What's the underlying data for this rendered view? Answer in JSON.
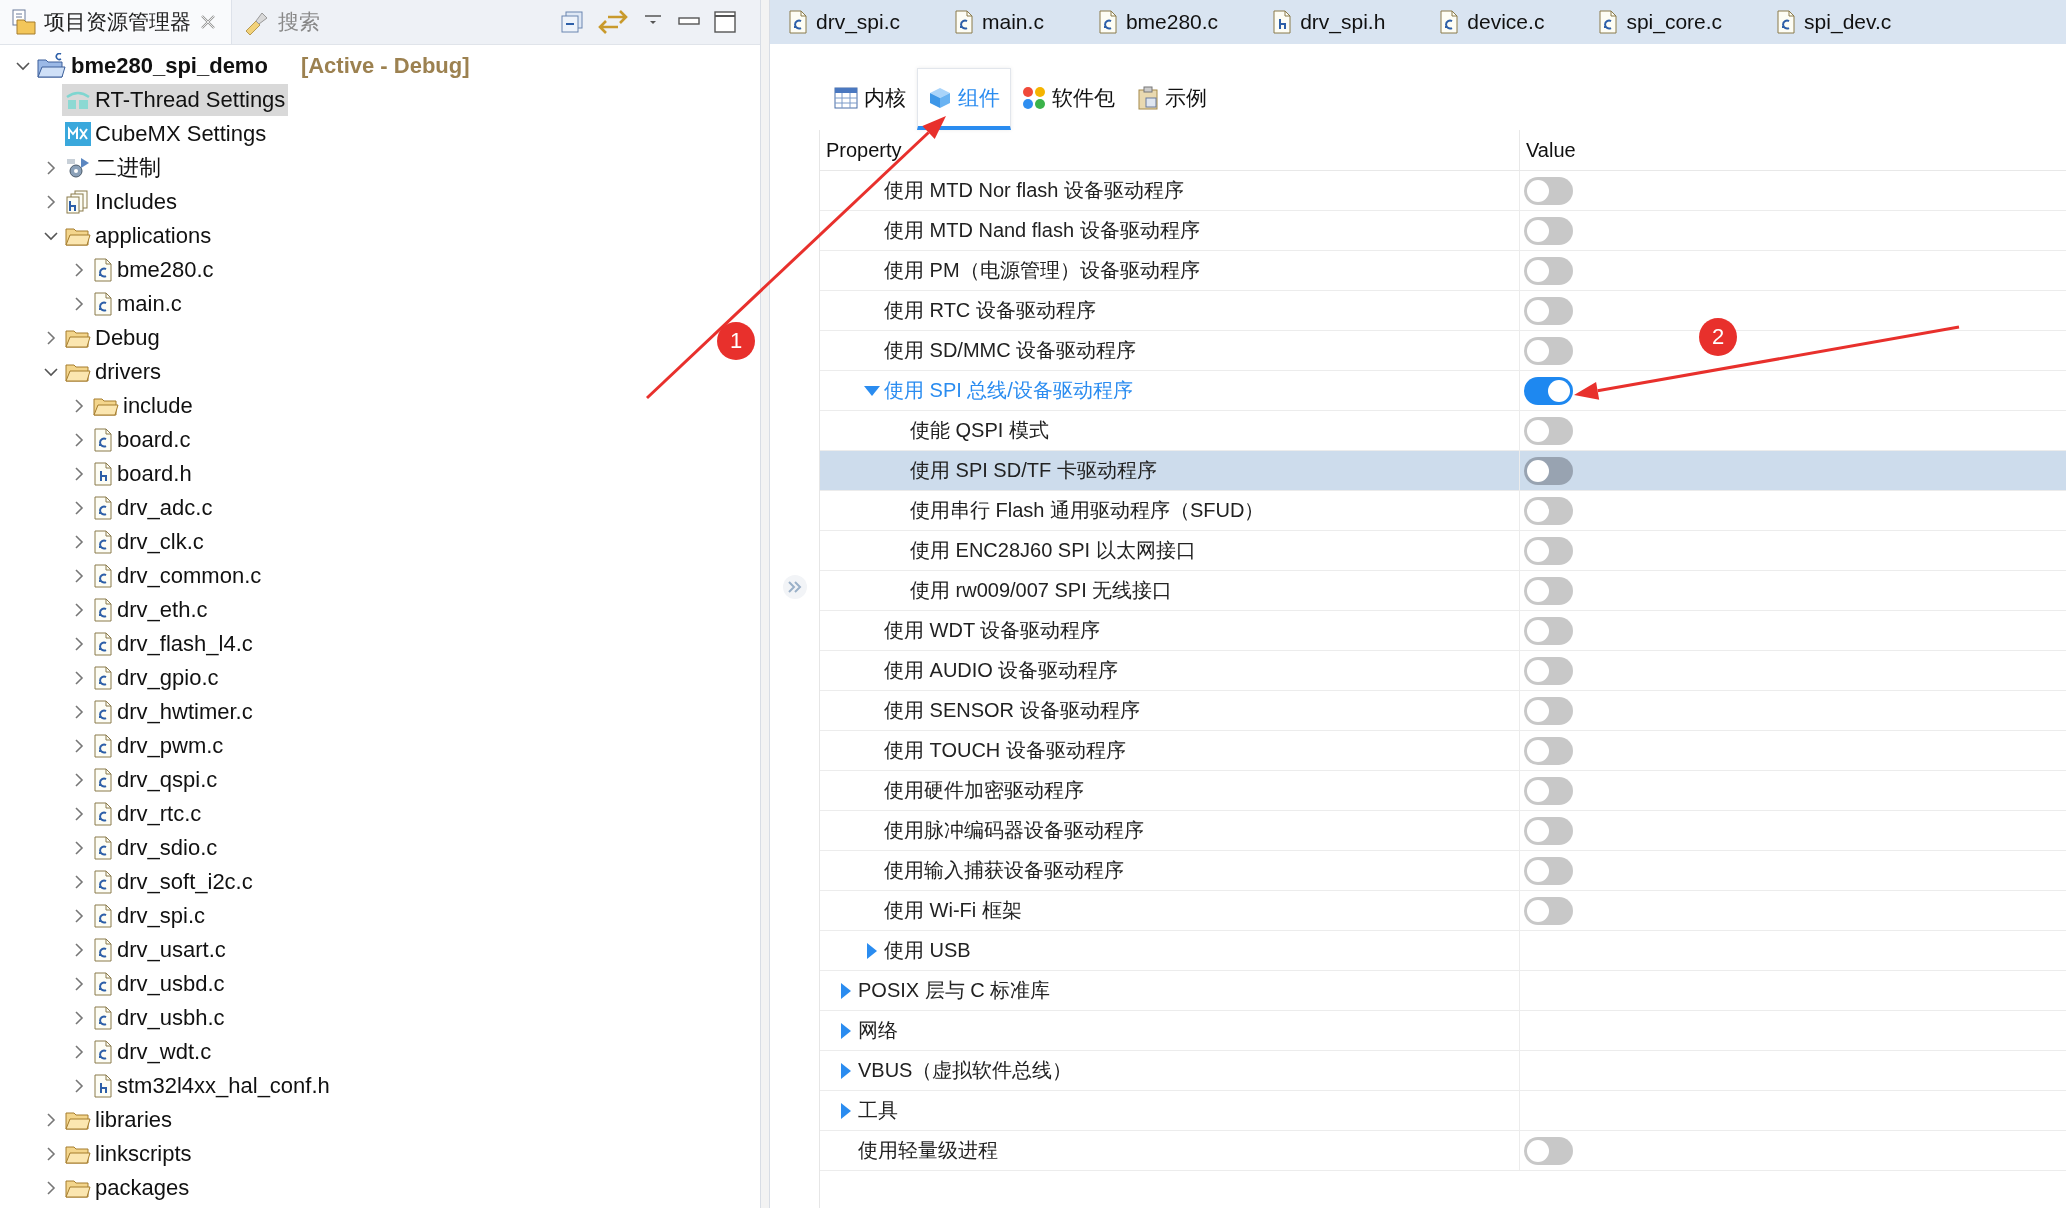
{
  "explorer": {
    "tabs": [
      {
        "label": "项目资源管理器",
        "kind": "explorer",
        "selected": true,
        "closable": true
      },
      {
        "label": "搜索",
        "kind": "search",
        "selected": false,
        "closable": false
      }
    ],
    "tree": [
      {
        "label": "bme280_spi_demo",
        "kind": "project",
        "note": "[Active - Debug]",
        "expanded": true,
        "selected": false,
        "children": [
          {
            "label": "RT-Thread Settings",
            "kind": "rt",
            "selected": true
          },
          {
            "label": "CubeMX Settings",
            "kind": "mx",
            "selected": false
          },
          {
            "label": "二进制",
            "kind": "binary",
            "expanded": false,
            "selected": false
          },
          {
            "label": "Includes",
            "kind": "includes",
            "expanded": false,
            "selected": false
          },
          {
            "label": "applications",
            "kind": "folder",
            "expanded": true,
            "selected": false,
            "children": [
              {
                "label": "bme280.c",
                "kind": "c",
                "expanded": false,
                "selected": false
              },
              {
                "label": "main.c",
                "kind": "c",
                "expanded": false,
                "selected": false
              }
            ]
          },
          {
            "label": "Debug",
            "kind": "folder",
            "expanded": false,
            "selected": false
          },
          {
            "label": "drivers",
            "kind": "folder",
            "expanded": true,
            "selected": false,
            "children": [
              {
                "label": "include",
                "kind": "folder",
                "expanded": false,
                "selected": false
              },
              {
                "label": "board.c",
                "kind": "c",
                "expanded": false,
                "selected": false
              },
              {
                "label": "board.h",
                "kind": "h",
                "expanded": false,
                "selected": false
              },
              {
                "label": "drv_adc.c",
                "kind": "c",
                "expanded": false,
                "selected": false
              },
              {
                "label": "drv_clk.c",
                "kind": "c",
                "expanded": false,
                "selected": false
              },
              {
                "label": "drv_common.c",
                "kind": "c",
                "expanded": false,
                "selected": false
              },
              {
                "label": "drv_eth.c",
                "kind": "c",
                "expanded": false,
                "selected": false
              },
              {
                "label": "drv_flash_l4.c",
                "kind": "c",
                "expanded": false,
                "selected": false
              },
              {
                "label": "drv_gpio.c",
                "kind": "c",
                "expanded": false,
                "selected": false
              },
              {
                "label": "drv_hwtimer.c",
                "kind": "c",
                "expanded": false,
                "selected": false
              },
              {
                "label": "drv_pwm.c",
                "kind": "c",
                "expanded": false,
                "selected": false
              },
              {
                "label": "drv_qspi.c",
                "kind": "c",
                "expanded": false,
                "selected": false
              },
              {
                "label": "drv_rtc.c",
                "kind": "c",
                "expanded": false,
                "selected": false
              },
              {
                "label": "drv_sdio.c",
                "kind": "c",
                "expanded": false,
                "selected": false
              },
              {
                "label": "drv_soft_i2c.c",
                "kind": "c",
                "expanded": false,
                "selected": false
              },
              {
                "label": "drv_spi.c",
                "kind": "c",
                "expanded": false,
                "selected": false
              },
              {
                "label": "drv_usart.c",
                "kind": "c",
                "expanded": false,
                "selected": false
              },
              {
                "label": "drv_usbd.c",
                "kind": "c",
                "expanded": false,
                "selected": false
              },
              {
                "label": "drv_usbh.c",
                "kind": "c",
                "expanded": false,
                "selected": false
              },
              {
                "label": "drv_wdt.c",
                "kind": "c",
                "expanded": false,
                "selected": false
              },
              {
                "label": "stm32l4xx_hal_conf.h",
                "kind": "h",
                "expanded": false,
                "selected": false
              }
            ]
          },
          {
            "label": "libraries",
            "kind": "folder",
            "expanded": false,
            "selected": false
          },
          {
            "label": "linkscripts",
            "kind": "folder",
            "expanded": false,
            "selected": false
          },
          {
            "label": "packages",
            "kind": "folder",
            "expanded": false,
            "selected": false
          }
        ]
      }
    ]
  },
  "editor_tabs": [
    {
      "label": "drv_spi.c",
      "kind": "c",
      "selected": false
    },
    {
      "label": "main.c",
      "kind": "c",
      "selected": false
    },
    {
      "label": "bme280.c",
      "kind": "c",
      "selected": false
    },
    {
      "label": "drv_spi.h",
      "kind": "h",
      "selected": false
    },
    {
      "label": "device.c",
      "kind": "c",
      "selected": false
    },
    {
      "label": "spi_core.c",
      "kind": "c",
      "selected": false
    },
    {
      "label": "spi_dev.c",
      "kind": "c",
      "selected": false
    }
  ],
  "settings_tabs": [
    {
      "label": "内核",
      "kind": "kernel",
      "selected": false
    },
    {
      "label": "组件",
      "kind": "components",
      "selected": true
    },
    {
      "label": "软件包",
      "kind": "packages",
      "selected": false
    },
    {
      "label": "示例",
      "kind": "examples",
      "selected": false
    }
  ],
  "properties": {
    "columns": [
      "Property",
      "Value"
    ],
    "rows": [
      {
        "children": [
          {
            "label": "使用 MTD Nor flash 设备驱动程序",
            "on": false,
            "selected": false
          },
          {
            "label": "使用 MTD Nand flash 设备驱动程序",
            "on": false,
            "selected": false
          },
          {
            "label": "使用 PM（电源管理）设备驱动程序",
            "on": false,
            "selected": false
          },
          {
            "label": "使用 RTC 设备驱动程序",
            "on": false,
            "selected": false
          },
          {
            "label": "使用 SD/MMC 设备驱动程序",
            "on": false,
            "selected": false
          },
          {
            "label": "使用 SPI 总线/设备驱动程序",
            "on": true,
            "expanded": true,
            "selected": false,
            "children": [
              {
                "label": "使能 QSPI 模式",
                "on": false,
                "selected": false
              },
              {
                "label": "使用 SPI SD/TF 卡驱动程序",
                "on": false,
                "selected": true
              },
              {
                "label": "使用串行 Flash 通用驱动程序（SFUD）",
                "on": false,
                "selected": false
              },
              {
                "label": "使用 ENC28J60 SPI 以太网接口",
                "on": false,
                "selected": false
              },
              {
                "label": "使用 rw009/007 SPI 无线接口",
                "on": false,
                "selected": false
              }
            ]
          },
          {
            "label": "使用 WDT 设备驱动程序",
            "on": false,
            "selected": false
          },
          {
            "label": "使用 AUDIO 设备驱动程序",
            "on": false,
            "selected": false
          },
          {
            "label": "使用 SENSOR 设备驱动程序",
            "on": false,
            "selected": false
          },
          {
            "label": "使用 TOUCH 设备驱动程序",
            "on": false,
            "selected": false
          },
          {
            "label": "使用硬件加密驱动程序",
            "on": false,
            "selected": false
          },
          {
            "label": "使用脉冲编码器设备驱动程序",
            "on": false,
            "selected": false
          },
          {
            "label": "使用输入捕获设备驱动程序",
            "on": false,
            "selected": false
          },
          {
            "label": "使用 Wi-Fi 框架",
            "on": false,
            "selected": false
          },
          {
            "label": "使用 USB",
            "expanded": false,
            "selected": false
          }
        ]
      },
      {
        "label": "POSIX 层与 C 标准库",
        "expanded": false,
        "selected": false
      },
      {
        "label": "网络",
        "expanded": false,
        "selected": false
      },
      {
        "label": "VBUS（虚拟软件总线）",
        "expanded": false,
        "selected": false
      },
      {
        "label": "工具",
        "expanded": false,
        "selected": false
      },
      {
        "label": "使用轻量级进程",
        "on": false,
        "selected": false
      }
    ]
  },
  "annotations": [
    {
      "number": "1"
    },
    {
      "number": "2"
    }
  ]
}
